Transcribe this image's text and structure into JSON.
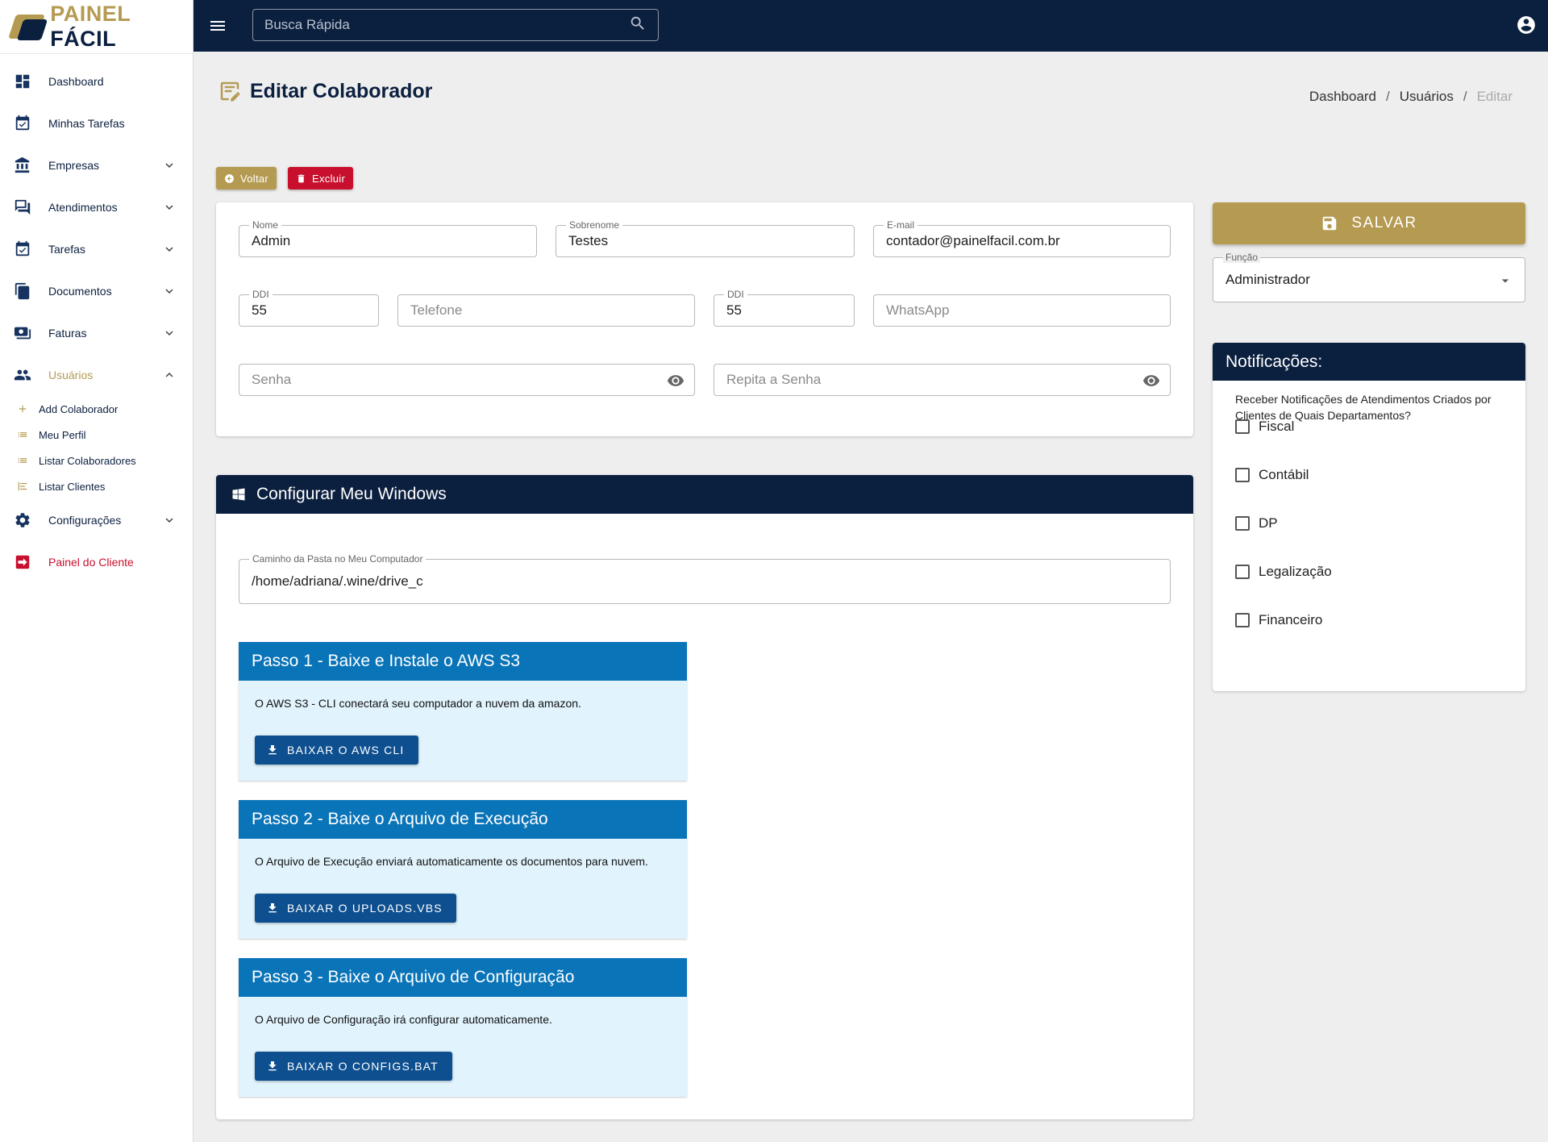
{
  "brand": {
    "part1": "PAINEL ",
    "part2": "FÁCIL"
  },
  "search": {
    "placeholder": "Busca Rápida"
  },
  "sidebar": {
    "items": [
      {
        "label": "Dashboard"
      },
      {
        "label": "Minhas Tarefas"
      },
      {
        "label": "Empresas"
      },
      {
        "label": "Atendimentos"
      },
      {
        "label": "Tarefas"
      },
      {
        "label": "Documentos"
      },
      {
        "label": "Faturas"
      },
      {
        "label": "Usuários"
      },
      {
        "label": "Configurações"
      },
      {
        "label": "Painel do Cliente"
      }
    ],
    "sub_items": [
      {
        "label": "Add Colaborador"
      },
      {
        "label": "Meu Perfil"
      },
      {
        "label": "Listar Colaboradores"
      },
      {
        "label": "Listar Clientes"
      }
    ]
  },
  "page": {
    "title": "Editar Colaborador",
    "breadcrumb": [
      "Dashboard",
      "Usuários",
      "Editar"
    ],
    "back_label": "Voltar",
    "delete_label": "Excluir"
  },
  "form": {
    "nome": {
      "label": "Nome",
      "value": "Admin"
    },
    "sobrenome": {
      "label": "Sobrenome",
      "value": "Testes"
    },
    "email": {
      "label": "E-mail",
      "value": "contador@painelfacil.com.br"
    },
    "ddi1": {
      "label": "DDI",
      "value": "55"
    },
    "telefone": {
      "placeholder": "Telefone"
    },
    "ddi2": {
      "label": "DDI",
      "value": "55"
    },
    "whatsapp": {
      "placeholder": "WhatsApp"
    },
    "senha": {
      "placeholder": "Senha"
    },
    "repita": {
      "placeholder": "Repita a Senha"
    }
  },
  "save": {
    "label": "SALVAR"
  },
  "funcao": {
    "label": "Função",
    "value": "Administrador"
  },
  "notifications": {
    "title": "Notificações:",
    "question": "Receber Notificações de Atendimentos Criados por Clientes de Quais Departamentos?",
    "options": [
      "Fiscal",
      "Contábil",
      "DP",
      "Legalização",
      "Financeiro"
    ]
  },
  "windows": {
    "title": "Configurar Meu Windows",
    "path": {
      "label": "Caminho da Pasta no Meu Computador",
      "value": "/home/adriana/.wine/drive_c"
    },
    "steps": [
      {
        "title": "Passo 1 - Baixe e Instale o AWS S3",
        "desc": "O AWS S3 - CLI conectará seu computador a nuvem da amazon.",
        "button": "BAIXAR O AWS CLI"
      },
      {
        "title": "Passo 2 - Baixe o Arquivo de Execução",
        "desc": "O Arquivo de Execução enviará automaticamente os documentos para nuvem.",
        "button": "BAIXAR O UPLOADS.VBS"
      },
      {
        "title": "Passo 3 - Baixe o Arquivo de Configuração",
        "desc": "O Arquivo de Configuração irá configurar automaticamente.",
        "button": "BAIXAR O CONFIGS.BAT"
      }
    ]
  },
  "colors": {
    "navy": "#0b1f3f",
    "gold": "#b59a52",
    "red": "#c8102e",
    "step_blue": "#0a74b8",
    "button_blue": "#0d4f8f",
    "step_bg": "#e1f3fc"
  }
}
